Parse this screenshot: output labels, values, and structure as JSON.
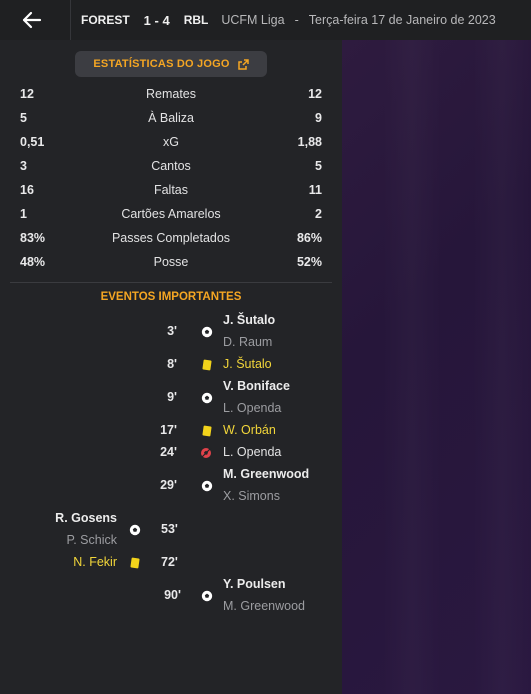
{
  "header": {
    "home_team": "FOREST",
    "score": "1 - 4",
    "away_team": "RBL",
    "competition": "UCFM Liga",
    "separator": "-",
    "date": "Terça-feira 17 de Janeiro de 2023"
  },
  "stats_button": {
    "label": "ESTATÍSTICAS DO JOGO"
  },
  "stats": [
    {
      "home": "12",
      "label": "Remates",
      "away": "12"
    },
    {
      "home": "5",
      "label": "À Baliza",
      "away": "9"
    },
    {
      "home": "0,51",
      "label": "xG",
      "away": "1,88"
    },
    {
      "home": "3",
      "label": "Cantos",
      "away": "5"
    },
    {
      "home": "16",
      "label": "Faltas",
      "away": "11"
    },
    {
      "home": "1",
      "label": "Cartões Amarelos",
      "away": "2"
    },
    {
      "home": "83%",
      "label": "Passes Completados",
      "away": "86%"
    },
    {
      "home": "48%",
      "label": "Posse",
      "away": "52%"
    }
  ],
  "events_title": "EVENTOS IMPORTANTES",
  "events": [
    {
      "minute": "3'",
      "side": "away",
      "type": "goal",
      "main": "J. Šutalo",
      "sub": "D. Raum"
    },
    {
      "minute": "8'",
      "side": "away",
      "type": "yellow-card",
      "main": "J. Šutalo"
    },
    {
      "minute": "9'",
      "side": "away",
      "type": "goal",
      "main": "V. Boniface",
      "sub": "L. Openda"
    },
    {
      "minute": "17'",
      "side": "away",
      "type": "yellow-card",
      "main": "W. Orbán"
    },
    {
      "minute": "24'",
      "side": "away",
      "type": "missed-chance",
      "main": "L. Openda"
    },
    {
      "minute": "29'",
      "side": "away",
      "type": "goal",
      "main": "M. Greenwood",
      "sub": "X. Simons"
    },
    {
      "minute": "53'",
      "side": "home",
      "type": "goal",
      "main": "R. Gosens",
      "sub": "P. Schick"
    },
    {
      "minute": "72'",
      "side": "home",
      "type": "yellow-card",
      "main": "N. Fekir"
    },
    {
      "minute": "90'",
      "side": "away",
      "type": "goal",
      "main": "Y. Poulsen",
      "sub": "M. Greenwood"
    }
  ],
  "colors": {
    "accent": "#f5a623",
    "yellow_card": "#f2d31b",
    "missed": "#e0424a"
  }
}
